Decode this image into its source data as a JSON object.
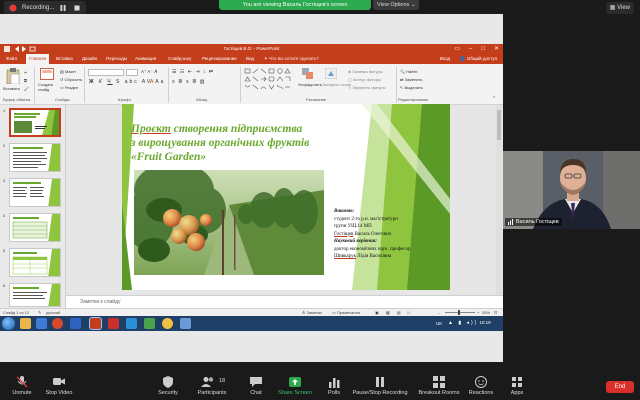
{
  "zoom_top": {
    "recording_label": "Recording...",
    "share_banner": "You are viewing Василь Гостіщев's screen",
    "view_options": "View Options ⌄",
    "view_label": "View"
  },
  "powerpoint": {
    "window_title": "Гостіщев В.О. - PowerPoint",
    "tabs": [
      "Файл",
      "Главная",
      "Вставка",
      "Дизайн",
      "Переходы",
      "Анимация",
      "Слайд-шоу",
      "Рецензирование",
      "Вид"
    ],
    "tell_me": "Что вы хотите сделать?",
    "sign_in": "Вход",
    "share": "Общий доступ",
    "ribbon": {
      "paste": "Вставить",
      "create_slide": "Создать слайд",
      "layout": "Макет",
      "reset": "Сбросить",
      "section": "Раздел",
      "group_clipboard": "Буфер обмена",
      "group_slides": "Слайды",
      "group_font": "Шрифт",
      "group_paragraph": "Абзац",
      "group_drawing": "Рисование",
      "group_editing": "Редактирование",
      "arrange": "Упорядочить",
      "express_styles": "Экспресс-стили",
      "shape_fill": "Заливка фигуры",
      "shape_outline": "Контур фигуры",
      "shape_effects": "Эффекты фигуры",
      "find": "Найти",
      "replace": "Заменить",
      "select": "Выделить"
    },
    "thumb_numbers": [
      "1",
      "2",
      "3",
      "4",
      "5",
      "6"
    ],
    "slide": {
      "title_part1": "Проєкт",
      "title_part2": " створення підприємства",
      "title_line2": "з вирощування органічних фруктів",
      "title_line3": "«Fruit Garden»",
      "performed_label": "Виконав:",
      "performed_line1": "студент 2-го р.н. магістратури",
      "performed_line2": "групи УЩ.14 МП",
      "performed_surname": "Гостіщев",
      "performed_rest": " Василь Олегович",
      "supervisor_label": "Науковий керівник:",
      "supervisor_line1": "доктор економічних наук, професор",
      "supervisor_surname": "Шивкарук",
      "supervisor_rest": " Лідія Василівна"
    },
    "notes_placeholder": "Заметки к слайду",
    "status": {
      "slide_counter": "Слайд 1 из 12",
      "language": "русский",
      "notes": "Заметки",
      "comments": "Примечания",
      "zoom": "35%"
    }
  },
  "taskbar": {
    "language": "UK",
    "time": "10:19"
  },
  "video": {
    "participant_name": "Василь Гостіщев"
  },
  "zoom_bottom": {
    "unmute": "Unmute",
    "stop_video": "Stop Video",
    "security": "Security",
    "participants": "Participants",
    "participants_count": "18",
    "chat": "Chat",
    "share_screen": "Share Screen",
    "polls": "Polls",
    "pause_recording": "Pause/Stop Recording",
    "breakout_rooms": "Breakout Rooms",
    "reactions": "Reactions",
    "apps": "Apps",
    "end": "End"
  },
  "colors": {
    "powerpoint_accent": "#c43e1c",
    "slide_green": "#6aa82d",
    "zoom_share_green": "#2da94f",
    "end_red": "#d9302c"
  }
}
